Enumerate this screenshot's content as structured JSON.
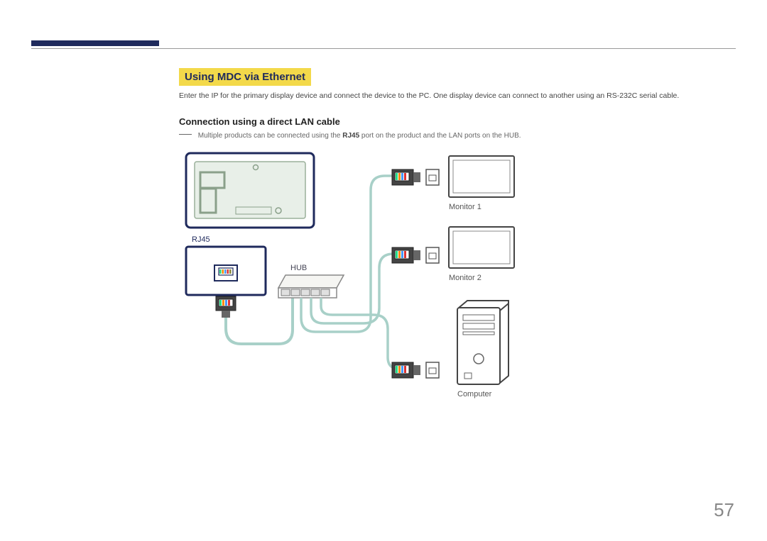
{
  "section_title": "Using MDC via Ethernet",
  "intro_text": "Enter the IP for the primary display device and connect the device to the PC. One display device can connect to another using an RS-232C serial cable.",
  "sub_title": "Connection using a direct LAN cable",
  "note_prefix": "Multiple products can be connected using the ",
  "note_bold": "RJ45",
  "note_suffix": " port on the product and the LAN ports on the HUB.",
  "labels": {
    "rj45": "RJ45",
    "hub": "HUB",
    "monitor1": "Monitor 1",
    "monitor2": "Monitor 2",
    "computer": "Computer"
  },
  "page_number": "57"
}
